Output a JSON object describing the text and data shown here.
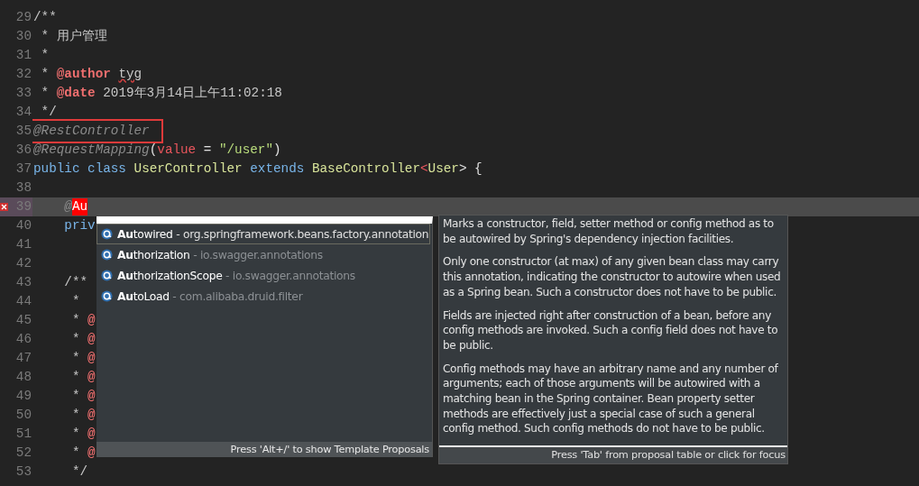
{
  "editor": {
    "lines": [
      {
        "number": "29",
        "segments": [
          {
            "text": "/**",
            "kind": "comment"
          }
        ]
      },
      {
        "number": "30",
        "segments": [
          {
            "text": " * 用户管理",
            "kind": "comment"
          }
        ]
      },
      {
        "number": "31",
        "segments": [
          {
            "text": " *",
            "kind": "comment"
          }
        ]
      },
      {
        "number": "32",
        "segments": [
          {
            "text": " * ",
            "kind": "comment"
          },
          {
            "text": "@author",
            "kind": "tag"
          },
          {
            "text": "tyg",
            "kind": "misspelled"
          }
        ]
      },
      {
        "number": "33",
        "segments": [
          {
            "text": " * ",
            "kind": "comment"
          },
          {
            "text": "@date",
            "kind": "tag"
          },
          {
            "text": " 2019年3月14日上午11:02:18",
            "kind": "comment"
          }
        ]
      },
      {
        "number": "34",
        "segments": [
          {
            "text": " */",
            "kind": "comment"
          }
        ]
      },
      {
        "number": "35",
        "highlighted": true,
        "segments": [
          {
            "text": "@RestController",
            "kind": "annotation"
          }
        ]
      },
      {
        "number": "36",
        "segments": [
          {
            "text": "@RequestMapping",
            "kind": "annotation"
          },
          {
            "text": "(",
            "kind": "plain"
          },
          {
            "text": "value",
            "kind": "param"
          },
          {
            "text": " = ",
            "kind": "plain"
          },
          {
            "text": "\"/user\"",
            "kind": "string"
          },
          {
            "text": ")",
            "kind": "plain"
          }
        ]
      },
      {
        "number": "37",
        "segments": [
          {
            "text": "public class ",
            "kind": "keyword"
          },
          {
            "text": "UserController",
            "kind": "type"
          },
          {
            "text": " extends ",
            "kind": "keyword"
          },
          {
            "text": "BaseController",
            "kind": "type"
          },
          {
            "text": "<",
            "kind": "param"
          },
          {
            "text": "User",
            "kind": "type"
          },
          {
            "text": "> {",
            "kind": "plain"
          }
        ]
      },
      {
        "number": "38"
      },
      {
        "number": "39",
        "current": true,
        "error": true,
        "segments": [
          {
            "text": "    @",
            "kind": "annotation"
          },
          {
            "text": "Au",
            "kind": "typed"
          }
        ]
      },
      {
        "number": "40",
        "segments": [
          {
            "text": "    priv",
            "kind": "keyword"
          }
        ]
      },
      {
        "number": "41"
      },
      {
        "number": "42"
      },
      {
        "number": "43",
        "segments": [
          {
            "text": "    /**",
            "kind": "comment"
          }
        ]
      },
      {
        "number": "44",
        "segments": [
          {
            "text": "     *",
            "kind": "comment"
          }
        ]
      },
      {
        "number": "45",
        "segments": [
          {
            "text": "     * ",
            "kind": "comment"
          },
          {
            "text": "@",
            "kind": "tag"
          }
        ]
      },
      {
        "number": "46",
        "segments": [
          {
            "text": "     * ",
            "kind": "comment"
          },
          {
            "text": "@",
            "kind": "tag"
          }
        ]
      },
      {
        "number": "47",
        "segments": [
          {
            "text": "     * ",
            "kind": "comment"
          },
          {
            "text": "@",
            "kind": "tag"
          }
        ]
      },
      {
        "number": "48",
        "segments": [
          {
            "text": "     * ",
            "kind": "comment"
          },
          {
            "text": "@",
            "kind": "tag"
          }
        ]
      },
      {
        "number": "49",
        "segments": [
          {
            "text": "     * ",
            "kind": "comment"
          },
          {
            "text": "@",
            "kind": "tag"
          }
        ]
      },
      {
        "number": "50",
        "segments": [
          {
            "text": "     * ",
            "kind": "comment"
          },
          {
            "text": "@",
            "kind": "tag"
          }
        ]
      },
      {
        "number": "51",
        "segments": [
          {
            "text": "     * ",
            "kind": "comment"
          },
          {
            "text": "@",
            "kind": "tag"
          }
        ]
      },
      {
        "number": "52",
        "segments": [
          {
            "text": "     * ",
            "kind": "comment"
          },
          {
            "text": "@",
            "kind": "tag"
          }
        ]
      },
      {
        "number": "53",
        "segments": [
          {
            "text": "     */",
            "kind": "comment"
          }
        ]
      }
    ]
  },
  "proposals": {
    "items": [
      {
        "name": "**Au**towired",
        "package": " - org.springframework.beans.factory.annotation",
        "selected": true
      },
      {
        "name": "**Au**thorization",
        "package": " - io.swagger.annotations",
        "selected": false
      },
      {
        "name": "**Au**thorizationScope",
        "package": " - io.swagger.annotations",
        "selected": false
      },
      {
        "name": "**Au**toLoad",
        "package": " - com.alibaba.druid.filter",
        "selected": false
      }
    ],
    "footer": "Press 'Alt+/' to show Template Proposals"
  },
  "documentation": {
    "paragraphs": [
      "Marks a constructor, field, setter method or config method as to be autowired by Spring's dependency injection facilities.",
      "Only one constructor (at max) of any given bean class may carry this annotation, indicating the constructor to autowire when used as a Spring bean. Such a constructor does not have to be public.",
      "Fields are injected right after construction of a bean, before any config methods are invoked. Such a config field does not have to be public.",
      "Config methods may have an arbitrary name and any number of arguments; each of those arguments will be autowired with a matching bean in the Spring container. Bean property setter methods are effectively just a special case of such a general config method. Such config methods do not have to be public."
    ],
    "footer": "Press 'Tab' from proposal table or click for focus"
  }
}
